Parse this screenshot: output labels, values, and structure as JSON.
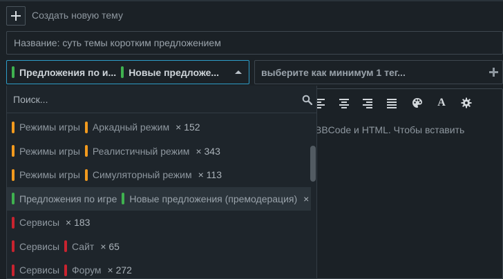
{
  "create": {
    "label": "Создать новую тему",
    "icon": "plus-icon"
  },
  "title_input": {
    "placeholder": "Название: суть темы коротким предложением"
  },
  "tag_select": {
    "chips": [
      {
        "label": "Предложения по и...",
        "color": "#3fb24f"
      },
      {
        "label": "Новые предложе...",
        "color": "#3fb24f"
      }
    ],
    "caret_icon": "caret-up-icon"
  },
  "tag_input": {
    "placeholder": "выберите как минимум 1 тег...",
    "add_icon": "plus-icon"
  },
  "editor": {
    "placeholder": "BBCode и HTML. Чтобы вставить",
    "toolbar": [
      "align-left-icon",
      "align-center-icon",
      "align-right-icon",
      "align-justify-icon",
      "palette-icon",
      "font-icon",
      "settings-icon"
    ],
    "font_glyph": "A"
  },
  "dropdown": {
    "search_placeholder": "Поиск...",
    "search_icon": "search-icon",
    "colors": {
      "orange": "#f29a1e",
      "green": "#3fb24f",
      "red": "#c8232f"
    },
    "options": [
      {
        "group": "Режимы игры",
        "group_color": "#f29a1e",
        "sub": "Аркадный режим",
        "sub_color": "#f29a1e",
        "count": "× 152",
        "highlighted": false
      },
      {
        "group": "Режимы игры",
        "group_color": "#f29a1e",
        "sub": "Реалистичный режим",
        "sub_color": "#f29a1e",
        "count": "× 343",
        "highlighted": false
      },
      {
        "group": "Режимы игры",
        "group_color": "#f29a1e",
        "sub": "Симуляторный режим",
        "sub_color": "#f29a1e",
        "count": "× 113",
        "highlighted": false
      },
      {
        "group": "Предложения по игре",
        "group_color": "#3fb24f",
        "sub": "Новые предложения (премодерация)",
        "sub_color": "#3fb24f",
        "count": "×",
        "highlighted": true
      },
      {
        "group": "Сервисы",
        "group_color": "#c8232f",
        "sub": "",
        "sub_color": "",
        "count": "× 183",
        "highlighted": false
      },
      {
        "group": "Сервисы",
        "group_color": "#c8232f",
        "sub": "Сайт",
        "sub_color": "#c8232f",
        "count": "× 65",
        "highlighted": false
      },
      {
        "group": "Сервисы",
        "group_color": "#c8232f",
        "sub": "Форум",
        "sub_color": "#c8232f",
        "count": "× 272",
        "highlighted": false
      }
    ]
  }
}
